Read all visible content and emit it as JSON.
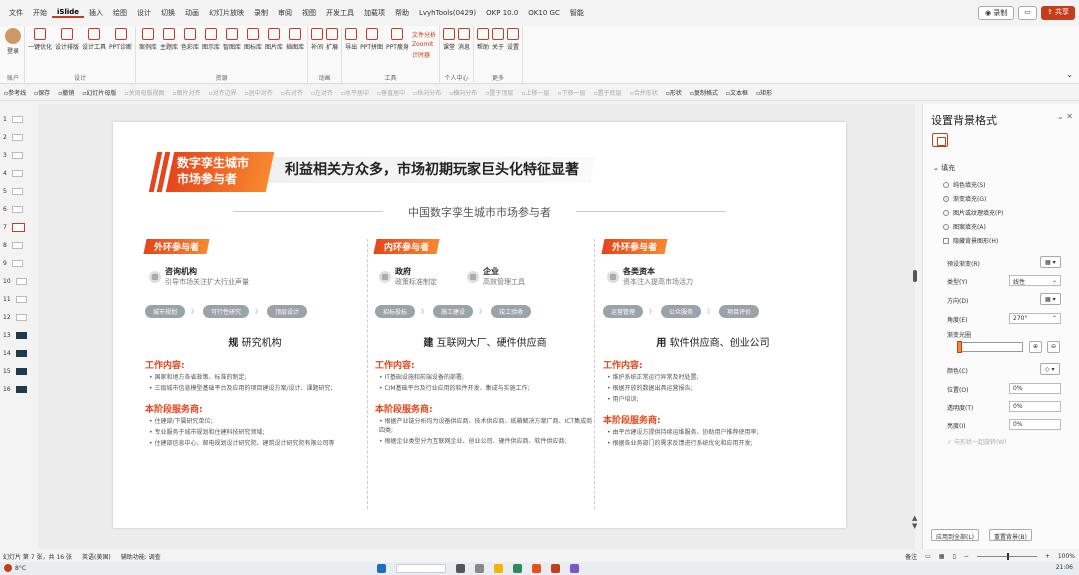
{
  "menubar": {
    "items": [
      "文件",
      "开始",
      "iSlide",
      "插入",
      "绘图",
      "设计",
      "切换",
      "动画",
      "幻灯片放映",
      "录制",
      "审阅",
      "视图",
      "开发工具",
      "加载项",
      "帮助",
      "LvyhTools(0429)",
      "OKP 10.0",
      "OK10 GC",
      "智能"
    ],
    "active_index": 2,
    "record_label": "录制",
    "comment_label": "",
    "share_label": "共享"
  },
  "ribbon": {
    "groups": [
      {
        "label": "账户",
        "buttons": [
          "登录"
        ]
      },
      {
        "label": "设计",
        "buttons": [
          "一键优化",
          "设计排版",
          "设计工具",
          "PPT诊断"
        ]
      },
      {
        "label": "资源",
        "buttons": [
          "案例库",
          "主题库",
          "色彩库",
          "图示库",
          "智图库",
          "图标库",
          "图片库",
          "插图库"
        ]
      },
      {
        "label": "动画",
        "buttons": [
          "补间",
          "扩展"
        ]
      },
      {
        "label": "工具",
        "buttons": [
          "导出",
          "PPT拼图",
          "PPT瘦身"
        ],
        "sub": [
          "文件分析",
          "ZoomIt",
          "计时器"
        ]
      },
      {
        "label": "个人中心",
        "buttons": [
          "课堂",
          "消息"
        ]
      },
      {
        "label": "更多",
        "buttons": [
          "帮助",
          "关于",
          "设置"
        ]
      }
    ]
  },
  "toolbar2": {
    "items": [
      "参考线",
      "保存",
      "撤销",
      "幻灯片母版",
      "关闭母版视图",
      "图片对齐",
      "对齐边界",
      "居中对齐",
      "右对齐",
      "左对齐",
      "水平居中",
      "垂直居中",
      "纵向分布",
      "横向分布",
      "置于顶层",
      "上移一层",
      "下移一层",
      "置于底层",
      "合并形状",
      "形状",
      "复制格式",
      "文本框",
      "矩形"
    ],
    "disabled": [
      "关闭母版视图",
      "图片对齐",
      "对齐边界",
      "居中对齐",
      "右对齐",
      "左对齐",
      "水平居中",
      "垂直居中",
      "纵向分布",
      "横向分布",
      "置于顶层",
      "上移一层",
      "下移一层",
      "置于底层",
      "合并形状"
    ]
  },
  "thumbs": [
    "1",
    "2",
    "3",
    "4",
    "5",
    "6",
    "7",
    "8",
    "9",
    "10",
    "11",
    "12",
    "13",
    "14",
    "15",
    "16"
  ],
  "thumbs_active": 6,
  "slide": {
    "tag": "数字孪生城市\n市场参与者",
    "title": "利益相关方众多，市场初期玩家巨头化特征显著",
    "subtitle": "中国数字孪生城市市场参与者",
    "columns": [
      {
        "tag": "外环参与者",
        "parts": [
          {
            "name": "咨询机构",
            "desc": "引导市场关注扩大行业声量"
          }
        ],
        "steps": [
          "城市规划",
          "可行性研究",
          "顶层设计"
        ],
        "head_bold": "规",
        "head_rest": " 研究机构",
        "work_title": "工作内容:",
        "work": [
          "国家和地方各省政策、标准的制定;",
          "三级城市信息模型基础平台及应用的项目建设方案/设计、课题研究;"
        ],
        "svc_title": "本阶段服务商:",
        "svc": [
          "住建部/下属研究单位;",
          "专业服务于城市规划和住建科技研究领域;",
          "住建部信息中心、邮电规划设计研究院、建筑设计研究院有限公司等"
        ]
      },
      {
        "tag": "内环参与者",
        "parts": [
          {
            "name": "政府",
            "desc": "政策标准制定"
          },
          {
            "name": "企业",
            "desc": "高效管理工具"
          }
        ],
        "steps": [
          "招标投标",
          "施工建设",
          "竣工验收"
        ],
        "head_bold": "建",
        "head_rest": " 互联网大厂、硬件供应商",
        "work_title": "工作内容:",
        "work": [
          "IT基础设施和前端设备的部署;",
          "CIM基础平台及行业应用的软件开发、集成与实施工作;"
        ],
        "svc_title": "本阶段服务商:",
        "svc": [
          "根据产业链分析均为设备供应商、技术供应商、纸箱解决方案厂商、ICT集成商四类;",
          "根据企业类型分为互联网企业、创业公司、硬件供应商、软件供应商;"
        ]
      },
      {
        "tag": "外环参与者",
        "parts": [
          {
            "name": "各类资本",
            "desc": "资本注入提高市场活力"
          }
        ],
        "steps": [
          "运营管理",
          "公众服务",
          "项目评价"
        ],
        "head_bold": "用",
        "head_rest": " 软件供应商、创业公司",
        "work_title": "工作内容:",
        "work": [
          "维护系统正常运行异常及时处置;",
          "根据开放的数据出具运营报告;",
          "用户培训;"
        ],
        "svc_title": "本阶段服务商:",
        "svc": [
          "由平台建设方提供持续运维服务、协助用户推荐使用率;",
          "根据各业务部门的需求反馈进行系统优化和应用开发;"
        ]
      }
    ]
  },
  "panel": {
    "title": "设置背景格式",
    "section": "填充",
    "fill_options": [
      "纯色填充(S)",
      "渐变填充(G)",
      "图片或纹理填充(P)",
      "图案填充(A)",
      "隐藏背景图形(H)"
    ],
    "fill_selected": 1,
    "preset_label": "预设渐变(R)",
    "type_label": "类型(Y)",
    "type_value": "线性",
    "direction_label": "方向(D)",
    "angle_label": "角度(E)",
    "angle_value": "270°",
    "stops_label": "渐变光圈",
    "color_label": "颜色(C)",
    "position_label": "位置(O)",
    "position_value": "0%",
    "transparency_label": "透明度(T)",
    "transparency_value": "0%",
    "brightness_label": "亮度(I)",
    "brightness_value": "0%",
    "rotate_label": "与形状一起旋转(W)",
    "apply_all": "应用到全部(L)",
    "reset": "重置背景(B)"
  },
  "status": {
    "slide_info": "幻灯片 第 7 张，共 16 张",
    "lang": "英语(美国)",
    "accessibility": "辅助功能: 调查",
    "notes": "备注",
    "zoom": "100%"
  },
  "taskbar": {
    "left": "8°C",
    "right": "21:06"
  },
  "colors": {
    "accent": "#c43e1c",
    "orange": "#e6451b",
    "orange_light": "#f7892f"
  }
}
